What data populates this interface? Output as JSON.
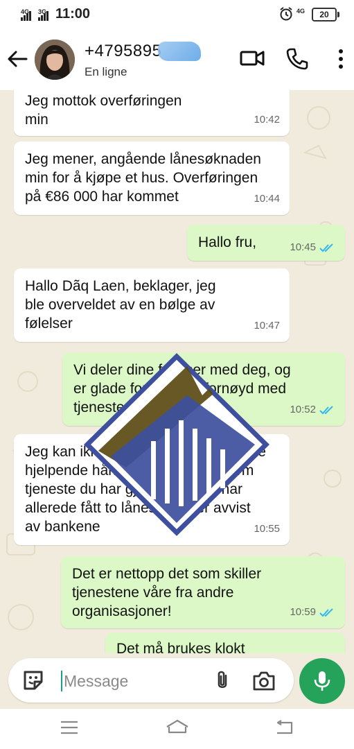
{
  "status_bar": {
    "sig1": "4G",
    "sig2": "3G",
    "time": "11:00",
    "net": "4G",
    "battery": "20",
    "icons": [
      "signal-icon",
      "alarm-icon",
      "battery-icon"
    ]
  },
  "header": {
    "contact_name": "+4795895",
    "contact_status": "En ligne",
    "icons": [
      "back-arrow-icon",
      "video-call-icon",
      "phone-icon",
      "more-vertical-icon"
    ]
  },
  "messages": [
    {
      "dir": "in",
      "lines": [
        "Jeg mottok overføringen",
        "min"
      ],
      "time": "10:42"
    },
    {
      "dir": "in",
      "lines": [
        "Jeg mener, angående lånesøknaden",
        "min for å kjøpe et hus. Overføringen",
        "på €86 000 har kommet"
      ],
      "time": "10:44"
    },
    {
      "dir": "out",
      "lines": [
        "Hallo fru,"
      ],
      "time": "10:45"
    },
    {
      "dir": "in",
      "lines": [
        "Hallo Dãq Laen, beklager, jeg",
        "ble overveldet av en bølge av",
        "følelser"
      ],
      "time": "10:47"
    },
    {
      "dir": "out",
      "lines": [
        "Vi deler dine følelser med deg, og",
        "er glade for at du er fornøyd med",
        "tjenestene våre"
      ],
      "time": "10:52"
    },
    {
      "dir": "in",
      "lines": [
        "Jeg kan ikke takke deg nok for denne",
        "hjelpende hånden. Det er en enorm",
        "tjeneste du har gjort meg. Jeg har",
        "allerede fått to lånesøknader avvist",
        "av bankene"
      ],
      "time": "10:55"
    },
    {
      "dir": "out",
      "lines": [
        "Det er nettopp det som skiller",
        "tjenestene våre fra andre",
        "organisasjoner!"
      ],
      "time": "10:59"
    },
    {
      "dir": "out",
      "lines": [
        "Det må brukes klokt"
      ],
      "time": ""
    }
  ],
  "input": {
    "placeholder": "Message",
    "icons": [
      "sticker-icon",
      "attach-icon",
      "camera-icon",
      "mic-icon"
    ]
  },
  "colors": {
    "outgoing_bubble": "#dcf8c6",
    "incoming_bubble": "#ffffff",
    "chat_background": "#f1ebdd",
    "read_ticks": "#34b7f1",
    "mic_button": "#25a35a",
    "watermark_blue": "#3d4f9e",
    "watermark_olive": "#5a4a12"
  },
  "navbar": {
    "icons": [
      "menu-icon",
      "home-icon",
      "back-icon"
    ]
  }
}
